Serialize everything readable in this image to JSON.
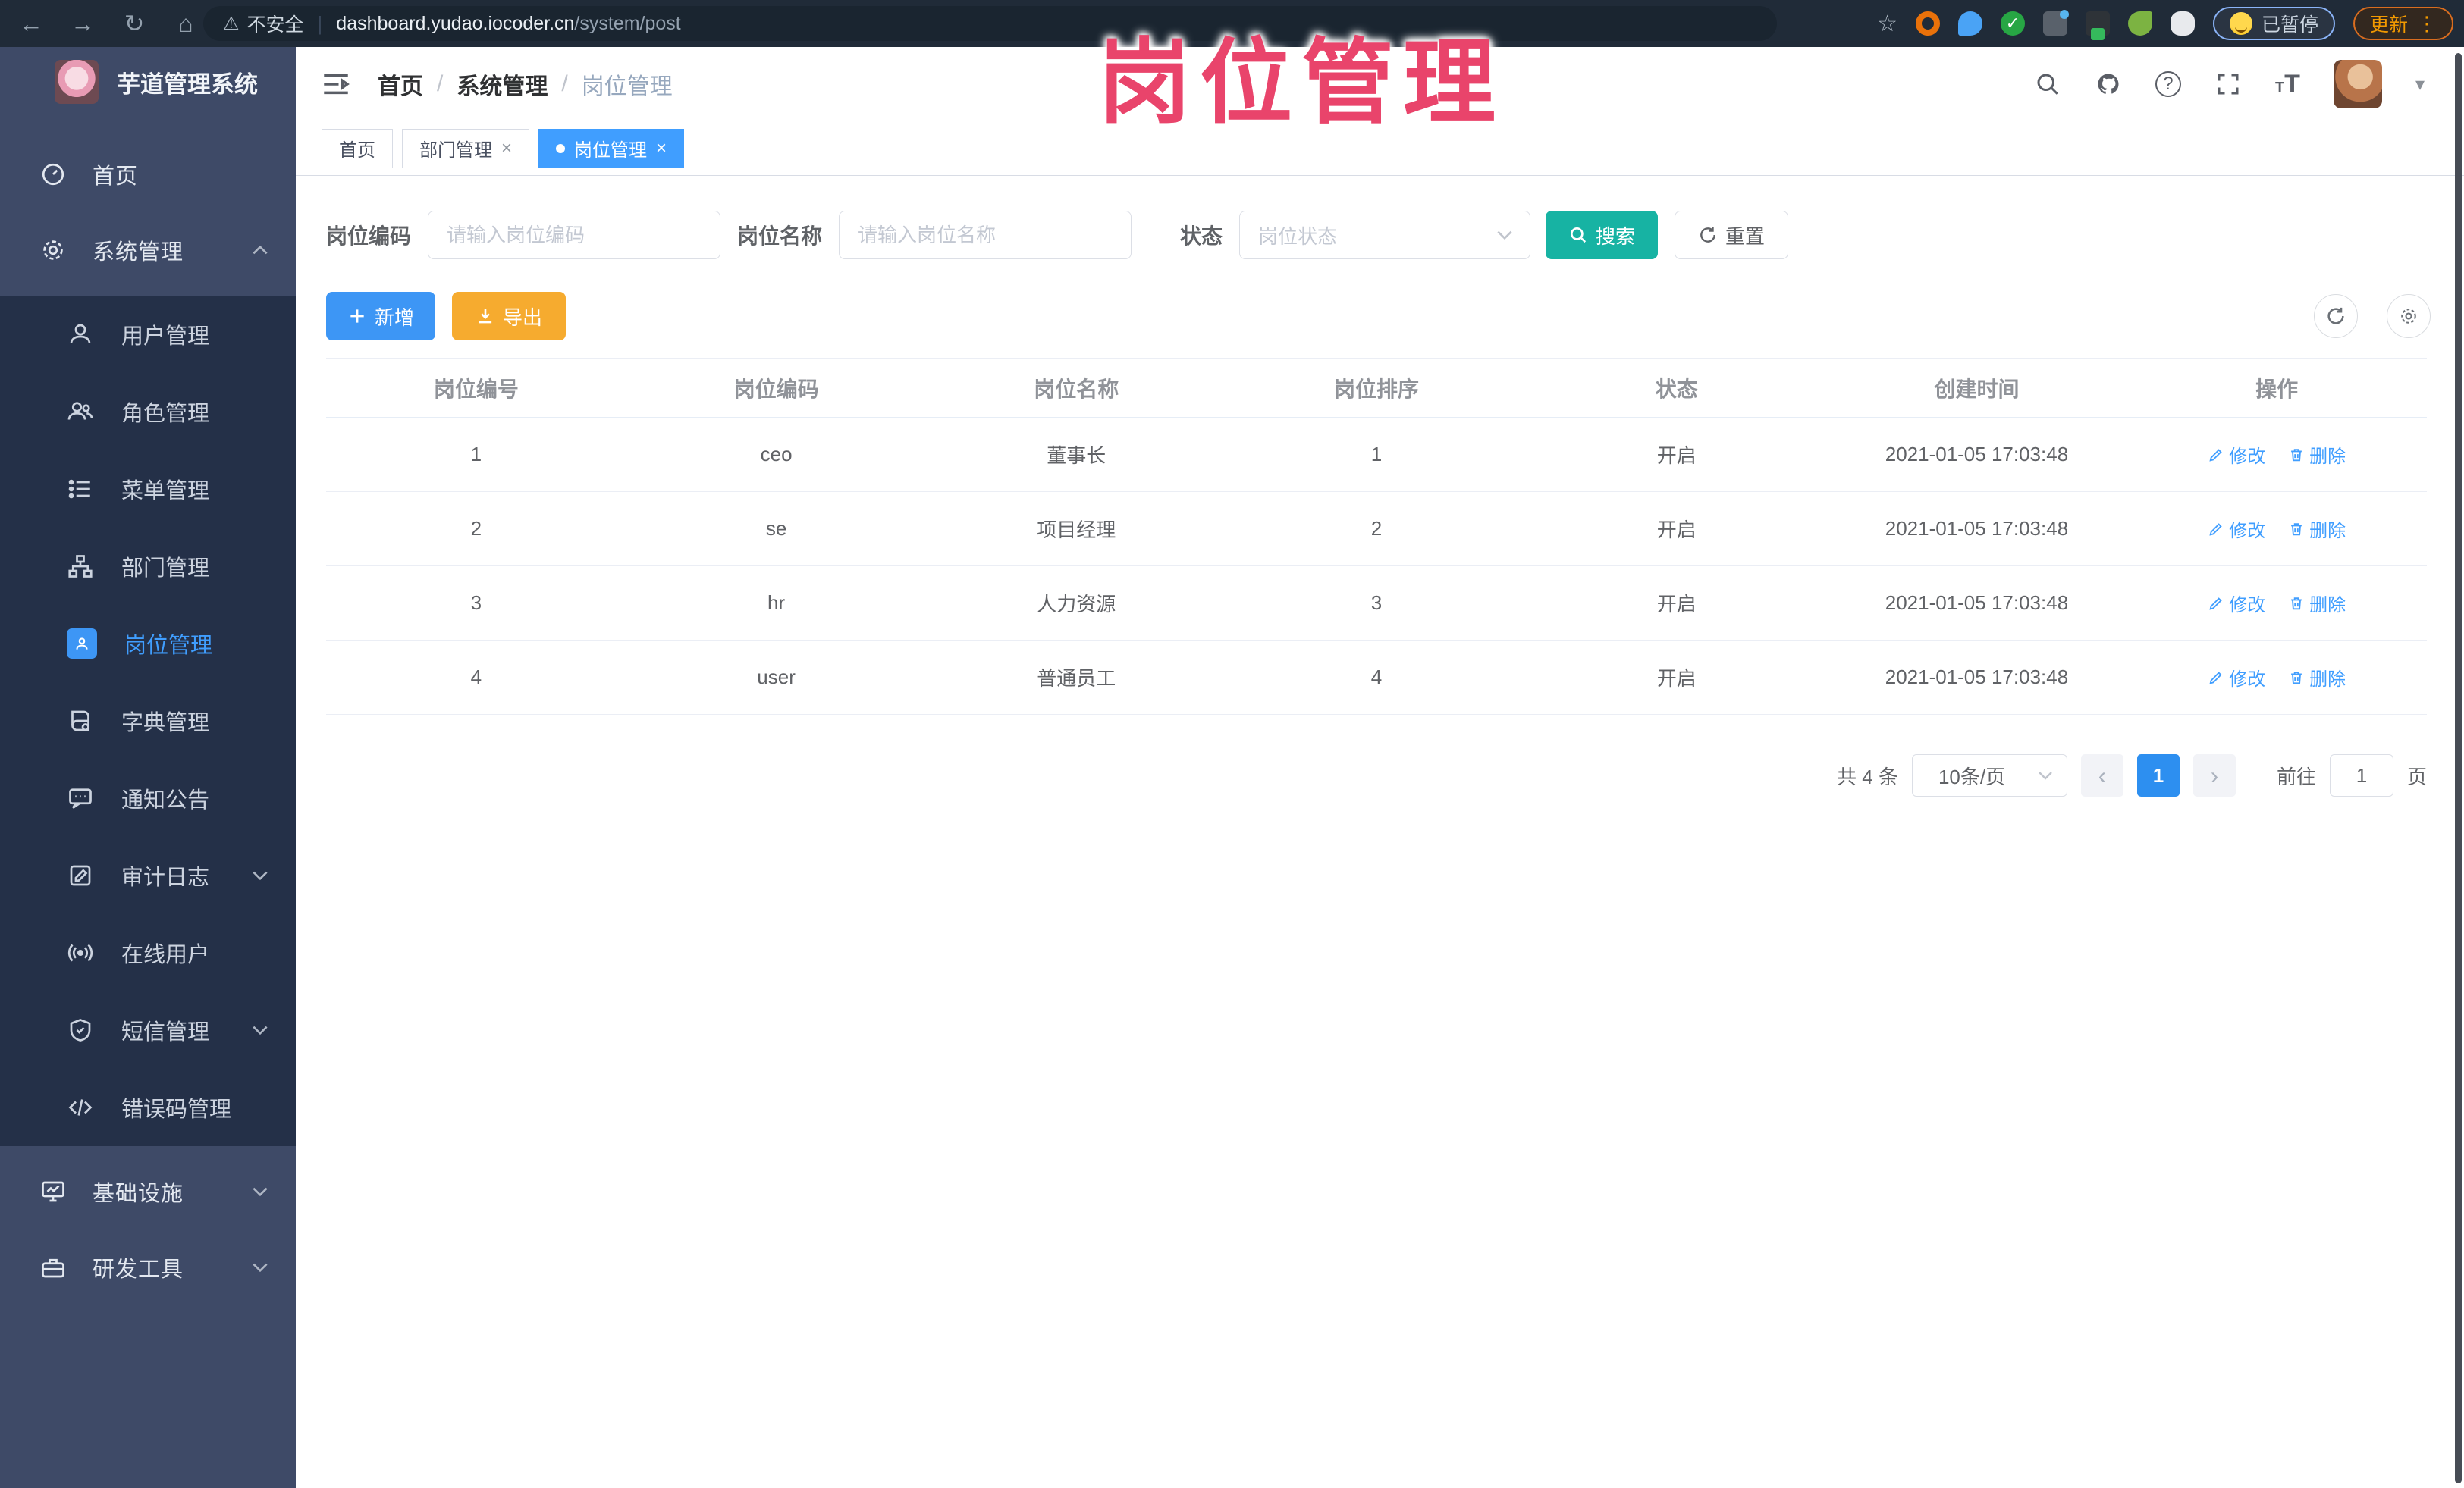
{
  "browser": {
    "security_label": "不安全",
    "url_domain": "dashboard.yudao.iocoder.cn",
    "url_path": "/system/post",
    "paused_label": "已暂停",
    "update_label": "更新"
  },
  "watermark_text": "岗位管理",
  "app": {
    "title": "芋道管理系统"
  },
  "breadcrumb": {
    "items": [
      "首页",
      "系统管理",
      "岗位管理"
    ]
  },
  "tabs": [
    {
      "label": "首页"
    },
    {
      "label": "部门管理"
    },
    {
      "label": "岗位管理"
    }
  ],
  "filters": {
    "code_label": "岗位编码",
    "code_placeholder": "请输入岗位编码",
    "name_label": "岗位名称",
    "name_placeholder": "请输入岗位名称",
    "status_label": "状态",
    "status_placeholder": "岗位状态",
    "search_label": "搜索",
    "reset_label": "重置"
  },
  "toolbar": {
    "add_label": "新增",
    "export_label": "导出"
  },
  "table": {
    "headers": [
      "岗位编号",
      "岗位编码",
      "岗位名称",
      "岗位排序",
      "状态",
      "创建时间",
      "操作"
    ],
    "edit_label": "修改",
    "delete_label": "删除",
    "rows": [
      {
        "id": "1",
        "code": "ceo",
        "name": "董事长",
        "sort": "1",
        "status": "开启",
        "created": "2021-01-05 17:03:48"
      },
      {
        "id": "2",
        "code": "se",
        "name": "项目经理",
        "sort": "2",
        "status": "开启",
        "created": "2021-01-05 17:03:48"
      },
      {
        "id": "3",
        "code": "hr",
        "name": "人力资源",
        "sort": "3",
        "status": "开启",
        "created": "2021-01-05 17:03:48"
      },
      {
        "id": "4",
        "code": "user",
        "name": "普通员工",
        "sort": "4",
        "status": "开启",
        "created": "2021-01-05 17:03:48"
      }
    ]
  },
  "pagination": {
    "total_text": "共 4 条",
    "page_size": "10条/页",
    "current_page": "1",
    "goto_label": "前往",
    "goto_value": "1",
    "page_unit": "页"
  },
  "sidebar": {
    "top_items": [
      {
        "label": "首页"
      },
      {
        "label": "系统管理"
      }
    ],
    "submenu": [
      {
        "label": "用户管理"
      },
      {
        "label": "角色管理"
      },
      {
        "label": "菜单管理"
      },
      {
        "label": "部门管理"
      },
      {
        "label": "岗位管理",
        "active": true
      },
      {
        "label": "字典管理"
      },
      {
        "label": "通知公告"
      },
      {
        "label": "审计日志"
      },
      {
        "label": "在线用户"
      },
      {
        "label": "短信管理"
      },
      {
        "label": "错误码管理"
      }
    ],
    "bottom_items": [
      {
        "label": "基础设施"
      },
      {
        "label": "研发工具"
      }
    ]
  },
  "colors": {
    "accent": "#409eff",
    "search_button": "#17b3a3",
    "export_button": "#f6ab2f",
    "active_page": "#2d8ff0",
    "watermark": "#e9446b"
  }
}
